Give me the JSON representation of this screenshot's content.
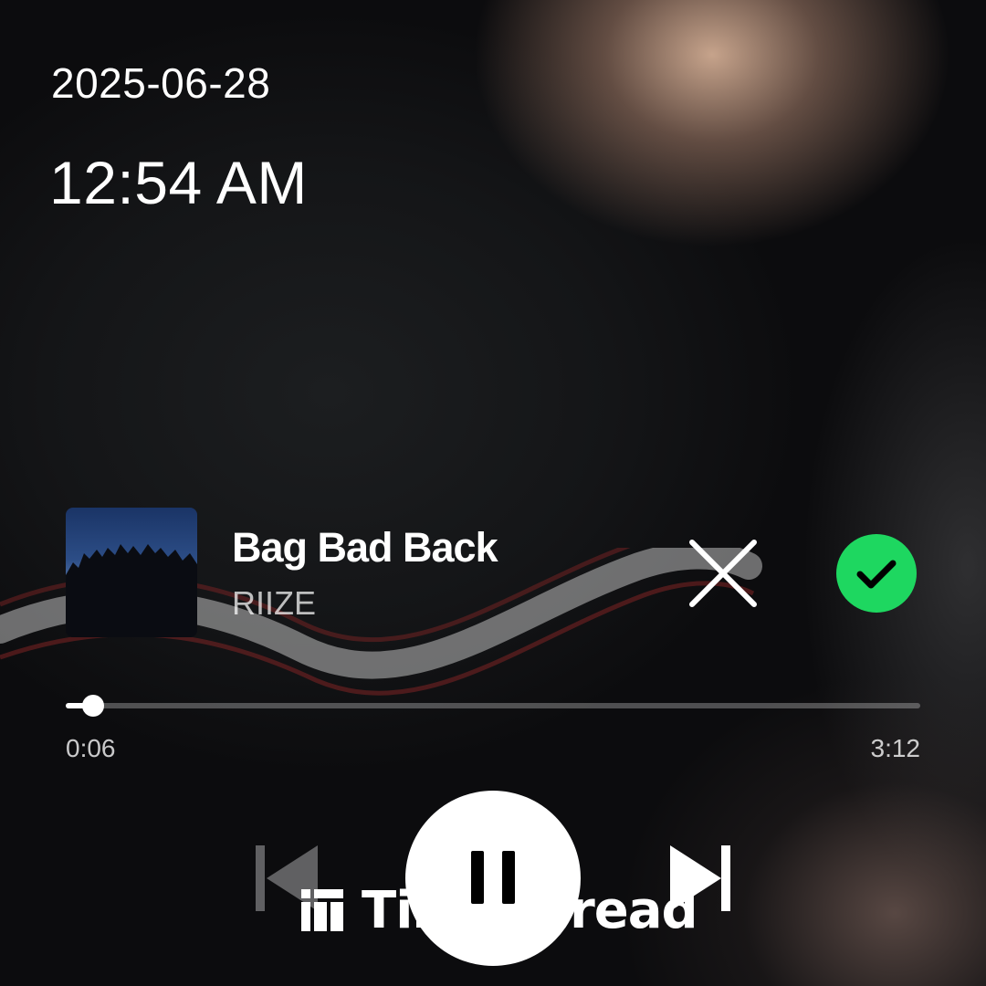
{
  "lock_screen": {
    "date": "2025-06-28",
    "time": "12:54 AM"
  },
  "now_playing": {
    "title": "Bag Bad Back",
    "artist": "RIIZE",
    "album_art_icon": "album-cover",
    "is_saved": true,
    "is_playing": true,
    "elapsed": "0:06",
    "duration": "3:12",
    "progress_fraction": 0.032
  },
  "controls": {
    "dismiss_icon": "close-icon",
    "saved_icon": "checkmark-circle-icon",
    "previous_icon": "skip-previous-icon",
    "play_pause_icon": "pause-icon",
    "next_icon": "skip-next-icon"
  },
  "overlay": {
    "brand_text": "TimeSpread",
    "brand_icon": "grid-logo-icon"
  },
  "colors": {
    "accent_green": "#1ed760",
    "text_primary": "#ffffff",
    "background": "#141517"
  }
}
